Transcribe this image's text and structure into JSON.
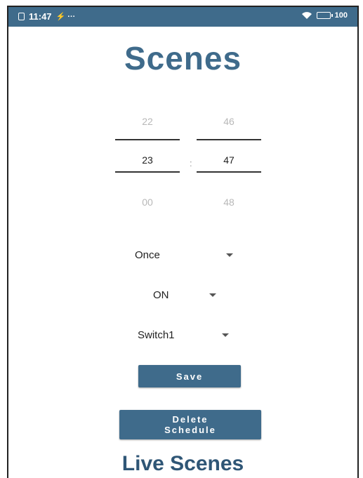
{
  "status_bar": {
    "time": "11:47",
    "indicators": "⚡ ···",
    "battery_label": "100",
    "icons": [
      "sim-icon",
      "wifi-icon",
      "battery-icon"
    ]
  },
  "header": {
    "title": "Scenes"
  },
  "time_picker": {
    "hour_prev": "22",
    "hour_current": "23",
    "hour_next": "00",
    "minute_prev": "46",
    "minute_current": "47",
    "minute_next": "48",
    "separator": ":"
  },
  "repeat_select": {
    "value": "Once"
  },
  "state_select": {
    "value": "ON"
  },
  "device_select": {
    "value": "Switch1"
  },
  "actions": {
    "save_label": "Save",
    "delete_line1": "Delete",
    "delete_line2": "Schedule"
  },
  "footer": {
    "live_title": "Live Scenes"
  },
  "colors": {
    "brand": "#3f6b8b",
    "button": "#3f6b8b",
    "text": "#222222",
    "faded": "#b8b8b8"
  }
}
